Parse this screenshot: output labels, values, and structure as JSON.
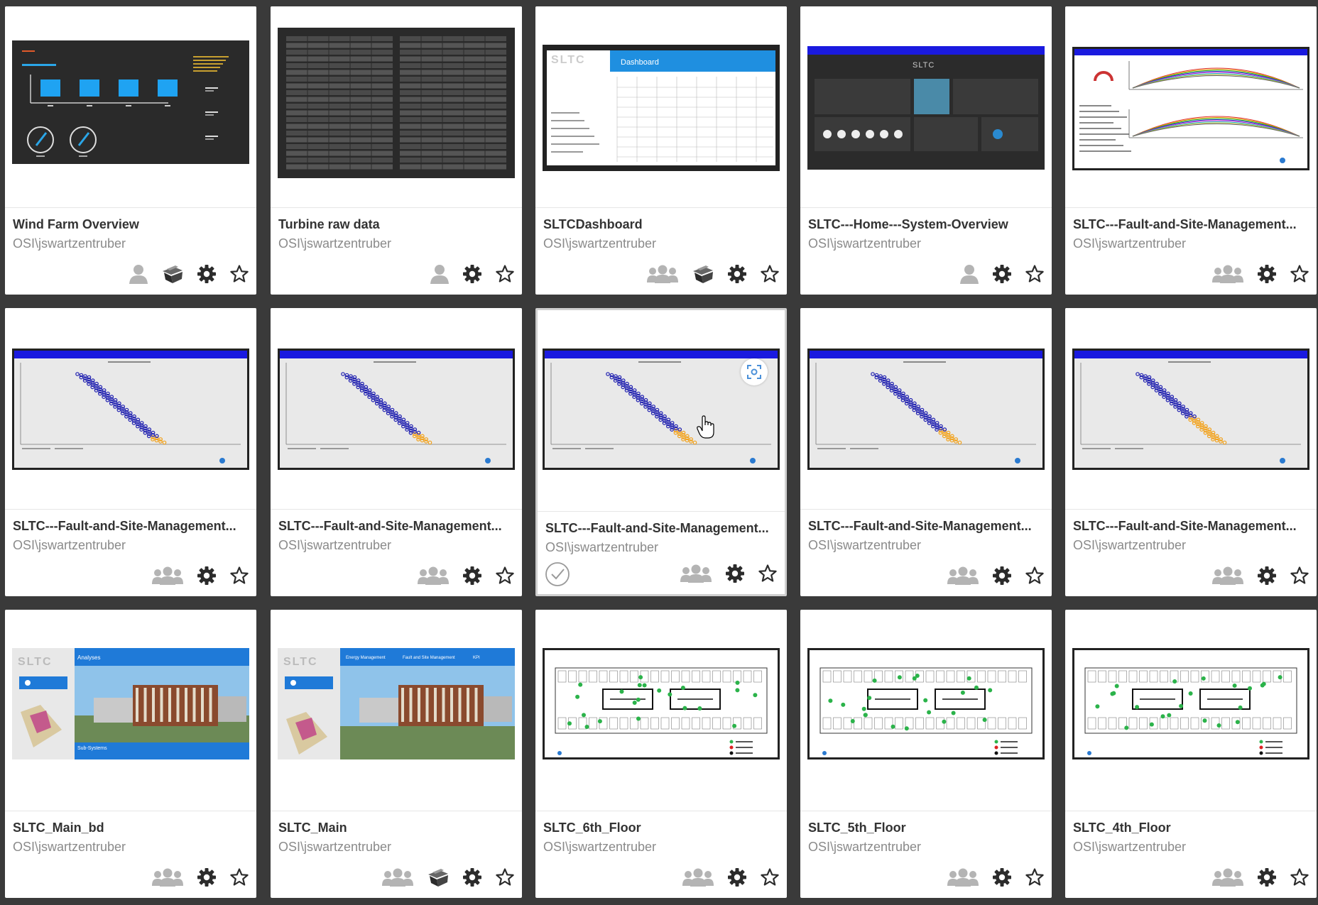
{
  "owner": "OSI\\jswartzentruber",
  "cards": [
    {
      "title": "Wind Farm Overview",
      "owner": "OSI\\jswartzentruber",
      "thumb": "dark-energy",
      "icons": [
        "user-icon",
        "layers-icon",
        "gear-icon",
        "star-icon"
      ]
    },
    {
      "title": "Turbine raw data",
      "owner": "OSI\\jswartzentruber",
      "thumb": "dark-table",
      "icons": [
        "user-icon",
        "gear-icon",
        "star-icon"
      ]
    },
    {
      "title": "SLTCDashboard",
      "owner": "OSI\\jswartzentruber",
      "thumb": "dashboard",
      "icons": [
        "group-icon",
        "layers-icon",
        "gear-icon",
        "star-icon"
      ]
    },
    {
      "title": "SLTC---Home---System-Overview",
      "owner": "OSI\\jswartzentruber",
      "thumb": "system-overview",
      "icons": [
        "user-icon",
        "gear-icon",
        "star-icon"
      ]
    },
    {
      "title": "SLTC---Fault-and-Site-Management...",
      "owner": "OSI\\jswartzentruber",
      "thumb": "operations",
      "icons": [
        "group-icon",
        "gear-icon",
        "star-icon"
      ]
    },
    {
      "title": "SLTC---Fault-and-Site-Management...",
      "owner": "OSI\\jswartzentruber",
      "thumb": "cooling",
      "icons": [
        "group-icon",
        "gear-icon",
        "star-icon"
      ]
    },
    {
      "title": "SLTC---Fault-and-Site-Management...",
      "owner": "OSI\\jswartzentruber",
      "thumb": "cooling",
      "icons": [
        "group-icon",
        "gear-icon",
        "star-icon"
      ]
    },
    {
      "title": "SLTC---Fault-and-Site-Management...",
      "owner": "OSI\\jswartzentruber",
      "thumb": "cooling",
      "icons": [
        "group-icon",
        "gear-icon",
        "star-icon"
      ],
      "selected": true
    },
    {
      "title": "SLTC---Fault-and-Site-Management...",
      "owner": "OSI\\jswartzentruber",
      "thumb": "cooling",
      "icons": [
        "group-icon",
        "gear-icon",
        "star-icon"
      ]
    },
    {
      "title": "SLTC---Fault-and-Site-Management...",
      "owner": "OSI\\jswartzentruber",
      "thumb": "cooling",
      "icons": [
        "group-icon",
        "gear-icon",
        "star-icon"
      ]
    },
    {
      "title": "SLTC_Main_bd",
      "owner": "OSI\\jswartzentruber",
      "thumb": "building-analyses",
      "icons": [
        "group-icon",
        "gear-icon",
        "star-icon"
      ]
    },
    {
      "title": "SLTC_Main",
      "owner": "OSI\\jswartzentruber",
      "thumb": "building-main",
      "icons": [
        "group-icon",
        "layers-icon",
        "gear-icon",
        "star-icon"
      ]
    },
    {
      "title": "SLTC_6th_Floor",
      "owner": "OSI\\jswartzentruber",
      "thumb": "floorplan",
      "icons": [
        "group-icon",
        "gear-icon",
        "star-icon"
      ]
    },
    {
      "title": "SLTC_5th_Floor",
      "owner": "OSI\\jswartzentruber",
      "thumb": "floorplan",
      "icons": [
        "group-icon",
        "gear-icon",
        "star-icon"
      ]
    },
    {
      "title": "SLTC_4th_Floor",
      "owner": "OSI\\jswartzentruber",
      "thumb": "floorplan",
      "icons": [
        "group-icon",
        "gear-icon",
        "star-icon"
      ]
    }
  ],
  "thumb_text": {
    "dashboard_header": "Dashboard",
    "analyses_header": "Analyses",
    "subsystems_header": "Sub-Systems",
    "nav_energy": "Energy Management",
    "nav_fault": "Fault and Site Management",
    "nav_kpi": "KPI"
  },
  "colors": {
    "background": "#3a3a3a",
    "card": "#ffffff",
    "title_text": "#333333",
    "owner_text": "#8a8a8a",
    "icon": "#2b2b2b",
    "icon_muted": "#b4b4b4",
    "blue_banner": "#1a1adf",
    "dot_blue": "#2020b0",
    "dot_orange": "#f2a21c"
  }
}
